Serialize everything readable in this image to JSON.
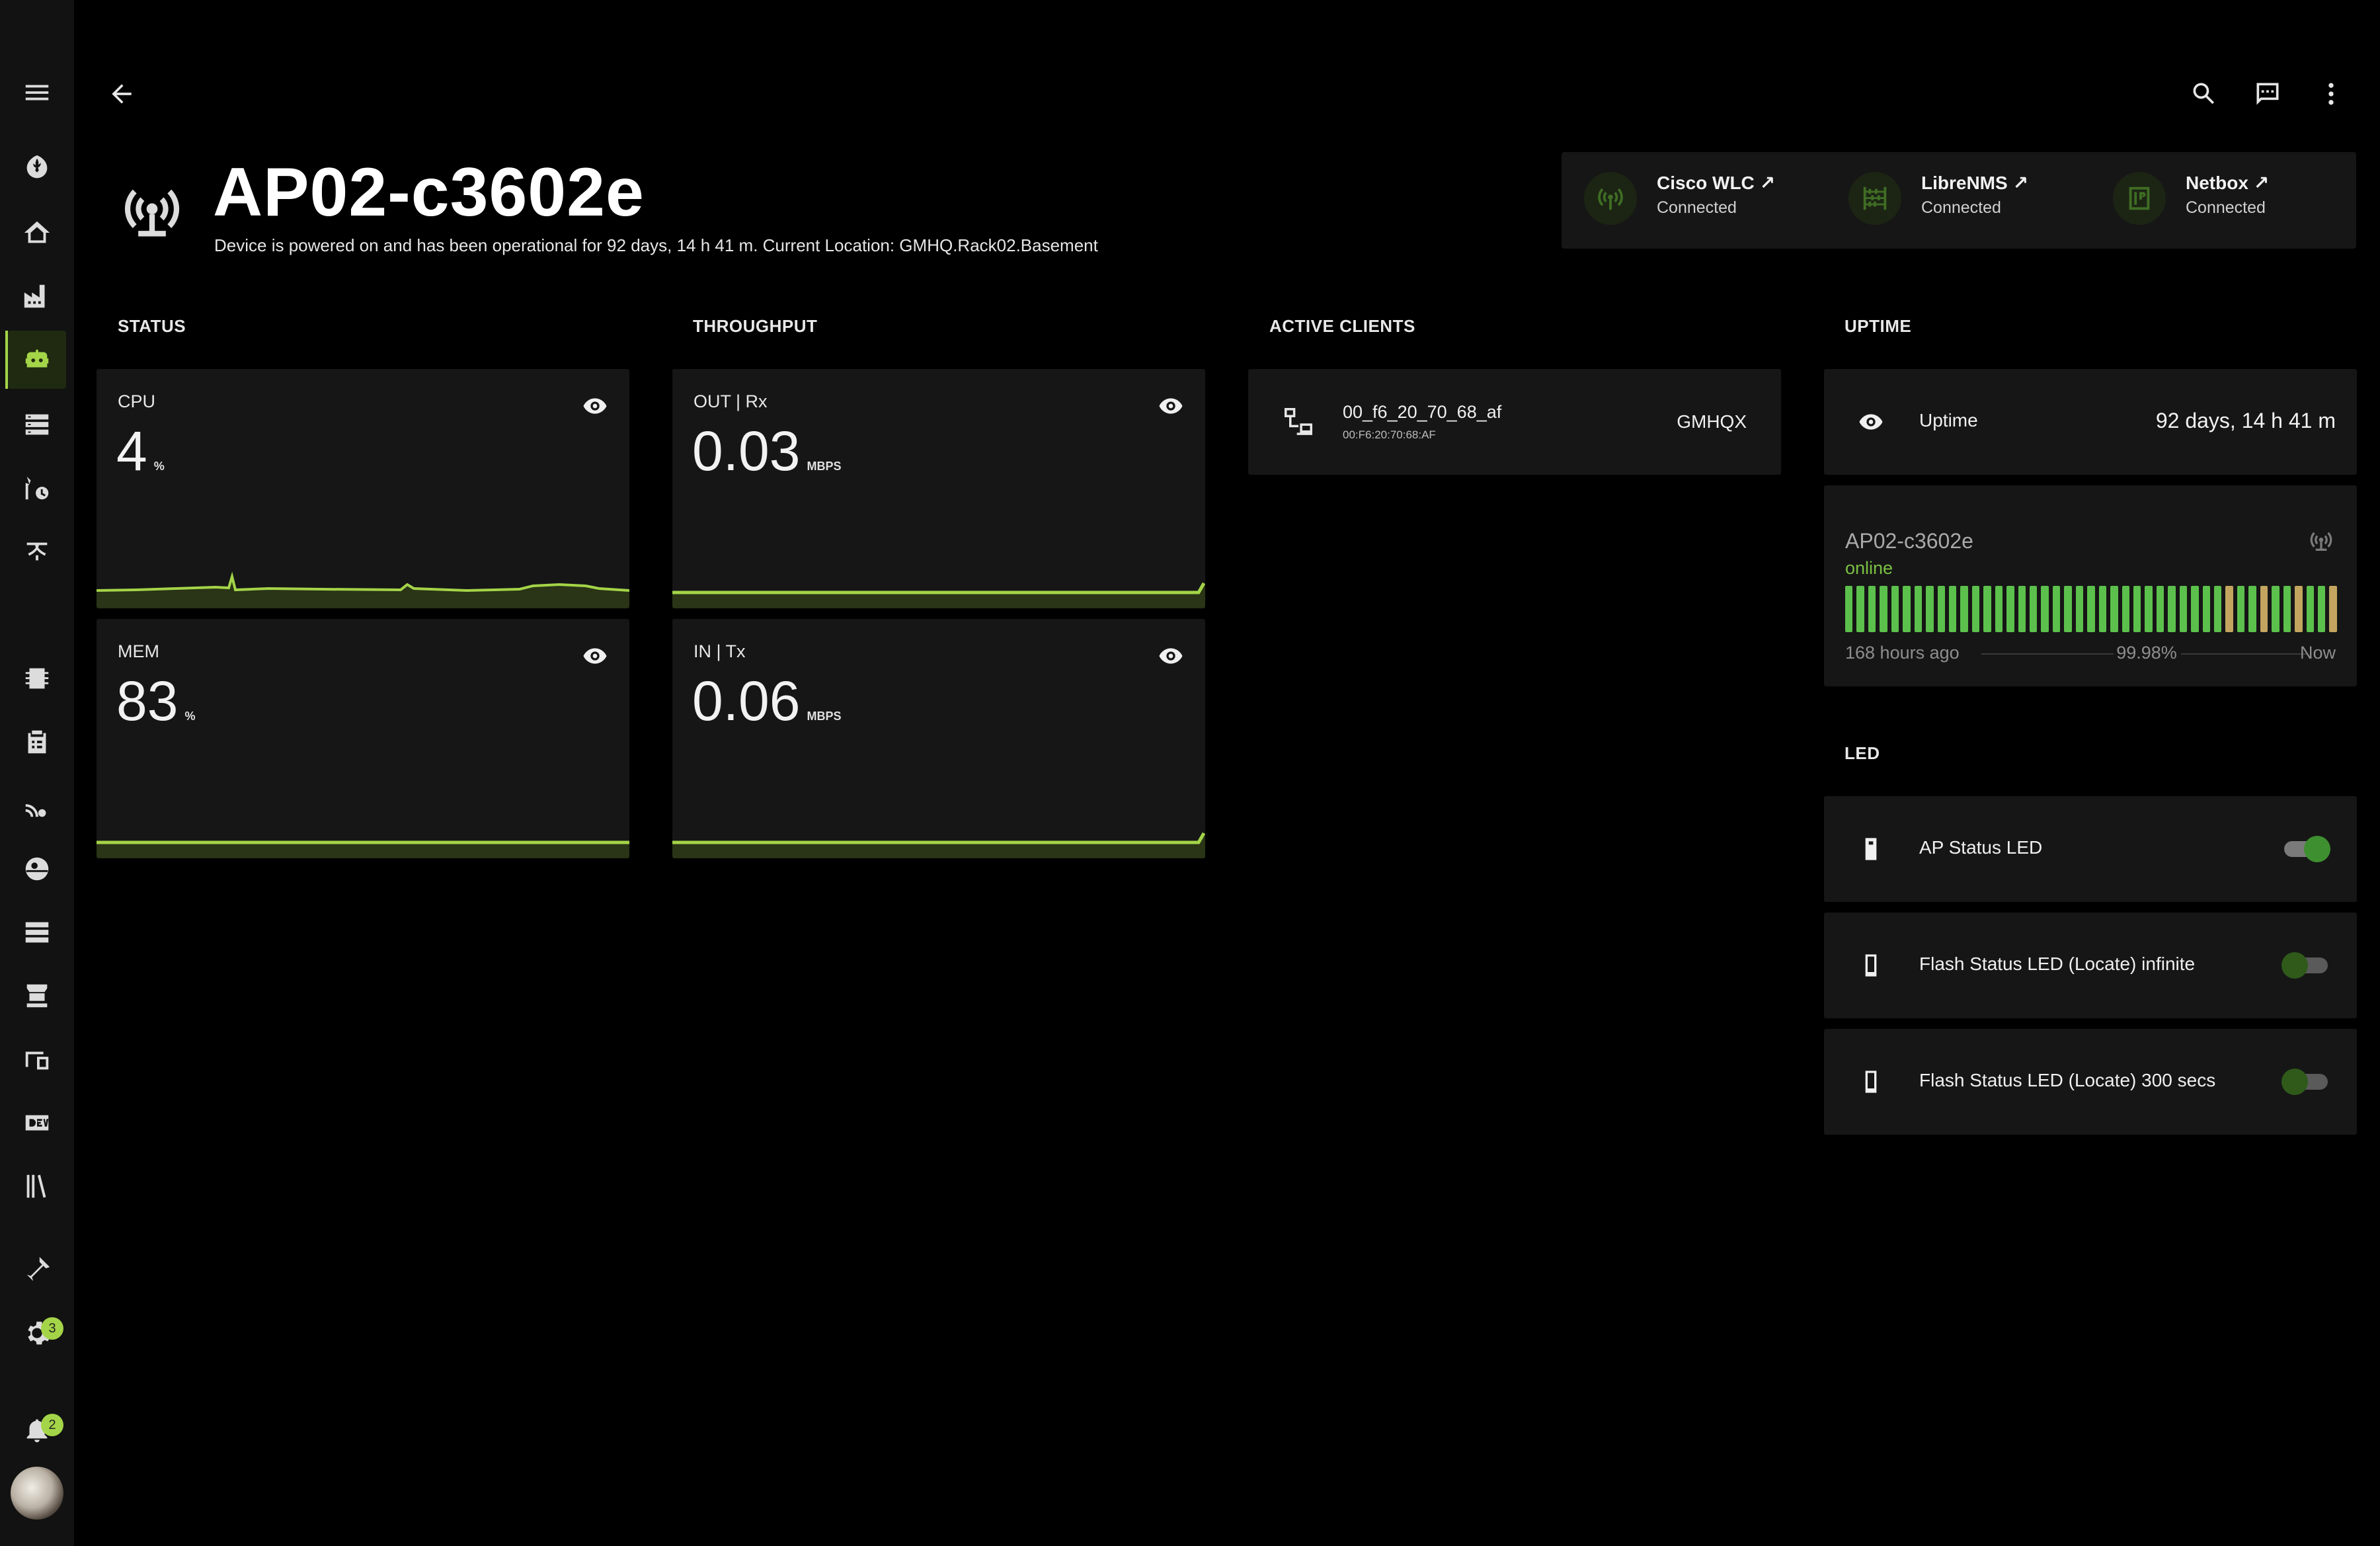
{
  "header": {
    "title": "AP02-c3602e",
    "subtitle": "Device is powered on and has been operational for 92 days, 14 h 41 m. Current Location: GMHQ.Rack02.Basement"
  },
  "integrations": [
    {
      "name": "Cisco WLC ↗",
      "status": "Connected",
      "icon": "antenna-icon"
    },
    {
      "name": "LibreNMS ↗",
      "status": "Connected",
      "icon": "abacus-icon"
    },
    {
      "name": "Netbox ↗",
      "status": "Connected",
      "icon": "netbox-icon"
    }
  ],
  "sections": {
    "status": "STATUS",
    "throughput": "THROUGHPUT",
    "active_clients": "ACTIVE CLIENTS",
    "uptime": "UPTIME",
    "led": "LED"
  },
  "status": {
    "cpu": {
      "label": "CPU",
      "value": "4",
      "unit": "%"
    },
    "mem": {
      "label": "MEM",
      "value": "83",
      "unit": "%"
    }
  },
  "throughput": {
    "out": {
      "label": "OUT | Rx",
      "value": "0.03",
      "unit": "MBPS"
    },
    "in": {
      "label": "IN | Tx",
      "value": "0.06",
      "unit": "MBPS"
    }
  },
  "clients": [
    {
      "name": "00_f6_20_70_68_af",
      "mac": "00:F6:20:70:68:AF",
      "location": "GMHQX"
    }
  ],
  "uptime": {
    "label": "Uptime",
    "value": "92 days, 14 h 41 m",
    "history": {
      "name": "AP02-c3602e",
      "status": "online",
      "left_label": "168 hours ago",
      "center_label": "99.98%",
      "right_label": "Now",
      "bars": [
        "ok",
        "ok",
        "ok",
        "ok",
        "ok",
        "ok",
        "ok",
        "ok",
        "ok",
        "ok",
        "ok",
        "ok",
        "ok",
        "ok",
        "ok",
        "ok",
        "ok",
        "ok",
        "ok",
        "ok",
        "ok",
        "ok",
        "ok",
        "ok",
        "ok",
        "ok",
        "ok",
        "ok",
        "ok",
        "ok",
        "ok",
        "ok",
        "ok",
        "warn",
        "ok",
        "ok",
        "warn",
        "ok",
        "ok",
        "warn",
        "ok",
        "ok",
        "warn"
      ]
    }
  },
  "led": [
    {
      "label": "AP Status LED",
      "on": true
    },
    {
      "label": "Flash Status LED (Locate) infinite",
      "on": false
    },
    {
      "label": "Flash Status LED (Locate) 300 secs",
      "on": false
    }
  ],
  "sidebar": {
    "badges": {
      "settings": "3",
      "notifications": "2"
    },
    "accent": "#a4d448"
  },
  "colors": {
    "accent": "#a4d448",
    "online": "#7ac143",
    "bar_ok": "#5cc04c",
    "bar_warn": "#c3a560"
  }
}
